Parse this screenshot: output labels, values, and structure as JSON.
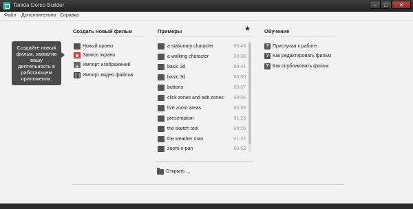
{
  "window": {
    "title": "Tanida Demo Builder",
    "controls": {
      "minimize": "–",
      "maximize": "□",
      "close": "✕"
    }
  },
  "menu": [
    "Файл",
    "Дополнительно",
    "Справка"
  ],
  "tooltip": "Создайте новый фильм, захватив вашу деятельность в работающем приложении.",
  "create": {
    "title": "Создать новый фильм",
    "items": [
      {
        "label": "Новый проект",
        "icon": "new-project-icon"
      },
      {
        "label": "Запись экрана",
        "icon": "record-icon"
      },
      {
        "label": "Импорт изображений",
        "icon": "image-icon"
      },
      {
        "label": "Импорт видео файлов",
        "icon": "film-icon"
      }
    ]
  },
  "examples": {
    "title": "Примеры",
    "star": "★",
    "items": [
      {
        "label": "a stationary character",
        "duration": "00:43"
      },
      {
        "label": "a walking character",
        "duration": "00:38"
      },
      {
        "label": "basic 2d",
        "duration": "00:44"
      },
      {
        "label": "basic 3d",
        "duration": "00:50"
      },
      {
        "label": "buttons",
        "duration": "00:57"
      },
      {
        "label": "click zones and edit zones",
        "duration": "00:56"
      },
      {
        "label": "live zoom areas",
        "duration": "00:38"
      },
      {
        "label": "presentation",
        "duration": "01:25"
      },
      {
        "label": "the sketch tool",
        "duration": "00:26"
      },
      {
        "label": "the weather man",
        "duration": "01:22"
      },
      {
        "label": "zoom-n-pan",
        "duration": "00:53"
      }
    ],
    "open_label": "Открыть ..."
  },
  "tutorials": {
    "title": "Обучение",
    "items": [
      {
        "label": "Приступая к работе"
      },
      {
        "label": "Как редактировать фильм"
      },
      {
        "label": "Как опубликовать фильм"
      }
    ]
  }
}
